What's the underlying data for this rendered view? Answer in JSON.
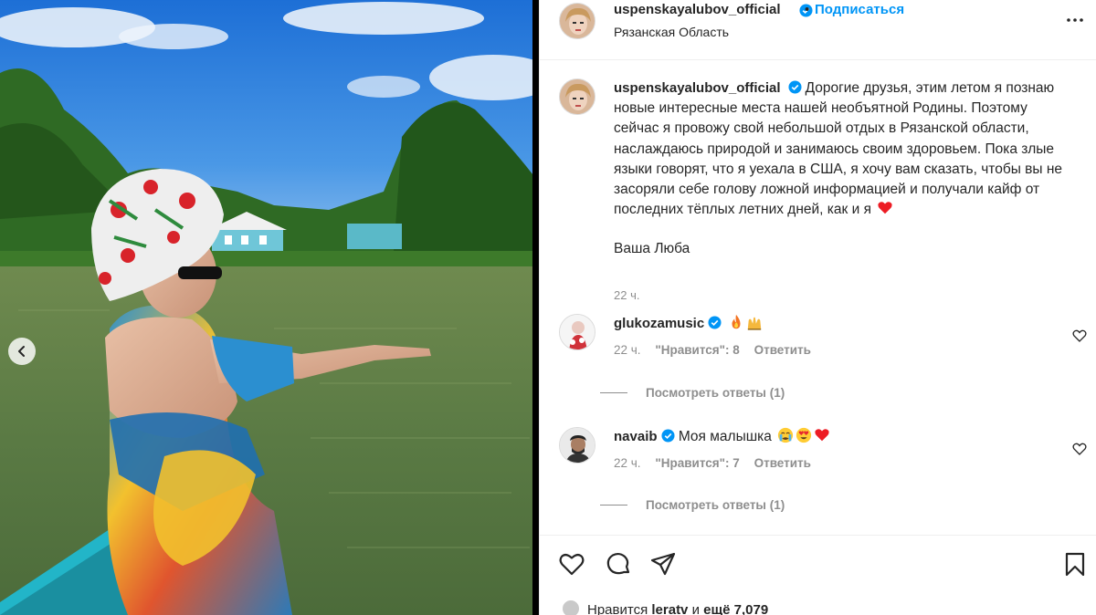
{
  "post": {
    "account": "uspenskayalubov_official",
    "dot": "•",
    "follow_label": "Подписаться",
    "location": "Рязанская Область"
  },
  "caption": {
    "username": "uspenskayalubov_official",
    "text": "Дорогие друзья, этим летом я познаю новые интересные места нашей необъятной Родины. Поэтому сейчас я провожу свой небольшой отдых в Рязанской области, наслаждаюсь природой и занимаюсь своим здоровьем. Пока злые языки говорят, что я уехала в США, я хочу вам сказать, чтобы вы не засоряли себе голову ложной информацией и получали кайф от последних тёплых летних дней, как и я",
    "signature": "Ваша Люба",
    "time": "22 ч."
  },
  "comments": [
    {
      "username": "glukozamusic",
      "text": "",
      "emojis": [
        "fire-emoji",
        "raising-hands-emoji"
      ],
      "time": "22 ч.",
      "likes_label": "\"Нравится\": 8",
      "reply_label": "Ответить",
      "view_replies": "Посмотреть ответы (1)"
    },
    {
      "username": "navaib",
      "text": "Моя малышка",
      "emojis": [
        "crying-face-emoji",
        "heart-eyes-emoji",
        "red-heart-emoji"
      ],
      "time": "22 ч.",
      "likes_label": "\"Нравится\": 7",
      "reply_label": "Ответить",
      "view_replies": "Посмотреть ответы (1)"
    }
  ],
  "likes": {
    "prefix": "Нравится",
    "user": "leratv",
    "joiner": "и",
    "rest": "ещё 7,079"
  },
  "colors": {
    "accent": "#0095f6",
    "verified": "#0095f6",
    "secondary_text": "#8e8e8e",
    "heart": "#ed1c24"
  },
  "icons": {
    "carousel_prev": "chevron-left-icon",
    "more": "ellipsis-icon",
    "like": "heart-outline-icon",
    "comment": "speech-bubble-icon",
    "share": "paper-plane-icon",
    "save": "bookmark-icon"
  }
}
